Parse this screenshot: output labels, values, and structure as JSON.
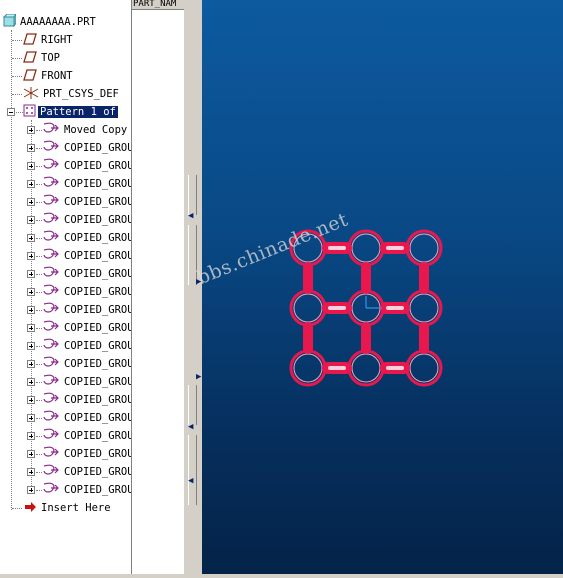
{
  "model_tree": {
    "root": "AAAAAAAA.PRT",
    "datums": [
      {
        "label": "RIGHT",
        "icon": "datum-plane-icon"
      },
      {
        "label": "TOP",
        "icon": "datum-plane-icon"
      },
      {
        "label": "FRONT",
        "icon": "datum-plane-icon"
      },
      {
        "label": "PRT_CSYS_DEF",
        "icon": "csys-icon"
      }
    ],
    "pattern": {
      "label": "Pattern 1 of",
      "icon": "pattern-icon"
    },
    "children": [
      "Moved Copy",
      "COPIED_GROU",
      "COPIED_GROU",
      "COPIED_GROU",
      "COPIED_GROU",
      "COPIED_GROU",
      "COPIED_GROU",
      "COPIED_GROU",
      "COPIED_GROU",
      "COPIED_GROU",
      "COPIED_GROU",
      "COPIED_GROU",
      "COPIED_GROU",
      "COPIED_GROU",
      "COPIED_GROU",
      "COPIED_GROU",
      "COPIED_GROU",
      "COPIED_GROU",
      "COPIED_GROU",
      "COPIED_GROU",
      "COPIED_GROU"
    ],
    "insert_here": "Insert Here"
  },
  "column_header": "PART_NAM",
  "viewport": {
    "watermark": "bbs.chinade.net",
    "colors": {
      "background_top": "#0d5aa0",
      "background_bottom": "#042347",
      "model": "#e8184f",
      "selection": "#0a246a"
    }
  }
}
